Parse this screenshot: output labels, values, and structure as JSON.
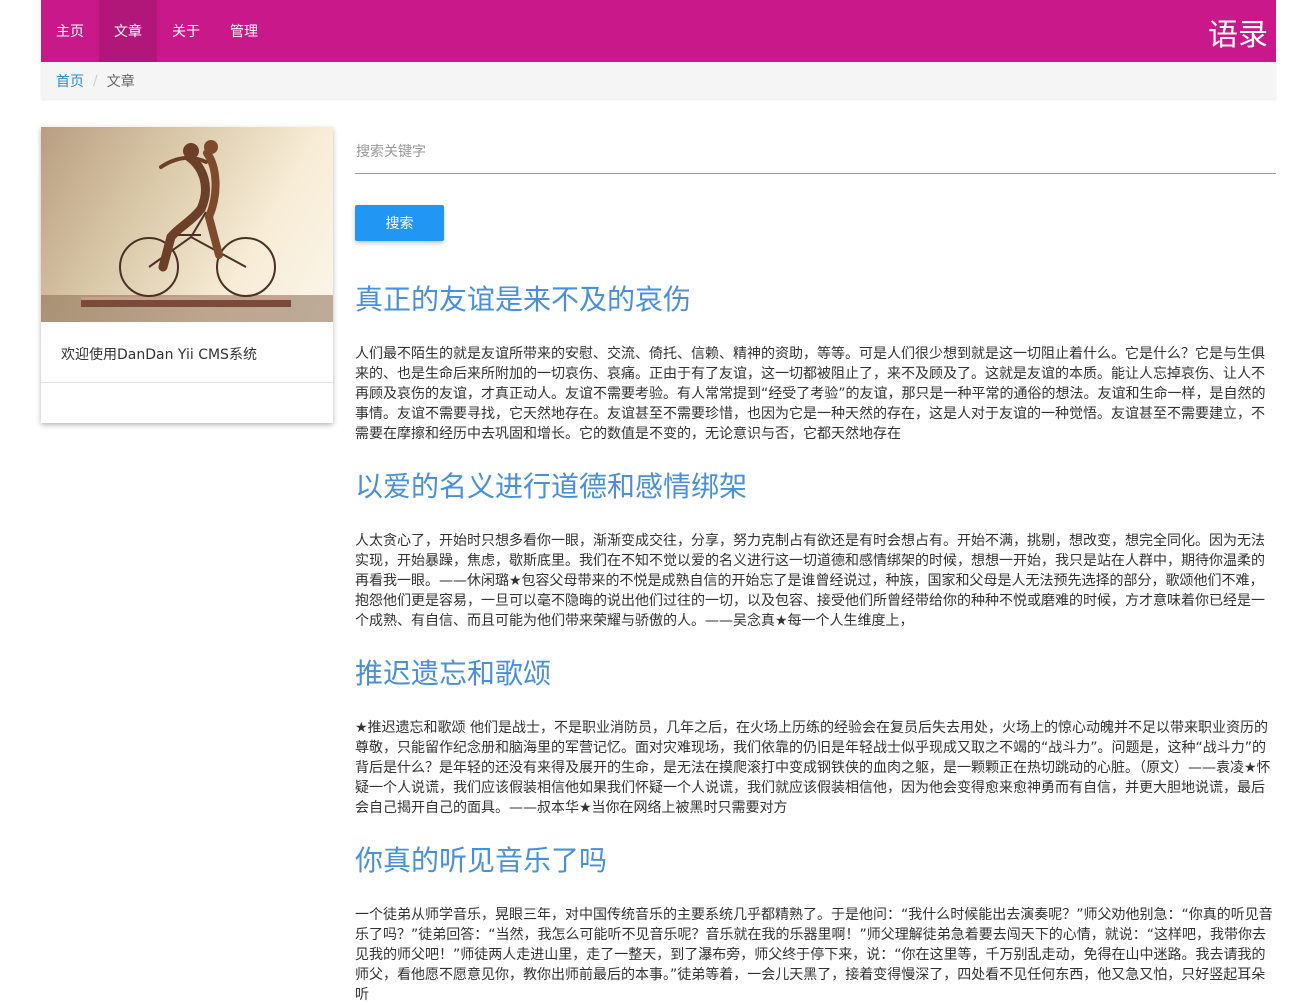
{
  "nav": {
    "items": [
      "主页",
      "文章",
      "关于",
      "管理"
    ],
    "active_index": 1,
    "brand": "语录",
    "color": "#c9188a"
  },
  "breadcrumb": {
    "home": "首页",
    "separator": "/",
    "current": "文章"
  },
  "sidebar": {
    "card_text": "欢迎使用DanDan Yii CMS系统"
  },
  "search": {
    "placeholder": "搜索关键字",
    "button_label": "搜索"
  },
  "articles": [
    {
      "title": "真正的友谊是来不及的哀伤",
      "body": "人们最不陌生的就是友谊所带来的安慰、交流、倚托、信赖、精神的资助，等等。可是人们很少想到就是这一切阻止着什么。它是什么？它是与生俱来的、也是生命后来所附加的一切哀伤、哀痛。正由于有了友谊，这一切都被阻止了，来不及顾及了。这就是友谊的本质。能让人忘掉哀伤、让人不再顾及哀伤的友谊，才真正动人。友谊不需要考验。有人常常提到“经受了考验”的友谊，那只是一种平常的通俗的想法。友谊和生命一样，是自然的事情。友谊不需要寻找，它天然地存在。友谊甚至不需要珍惜，也因为它是一种天然的存在，这是人对于友谊的一种觉悟。友谊甚至不需要建立，不需要在摩擦和经历中去巩固和增长。它的数值是不变的，无论意识与否，它都天然地存在"
    },
    {
      "title": "以爱的名义进行道德和感情绑架",
      "body": "人太贪心了，开始时只想多看你一眼，渐渐变成交往，分享，努力克制占有欲还是有时会想占有。开始不满，挑剔，想改变，想完全同化。因为无法实现，开始暴躁，焦虑，歇斯底里。我们在不知不觉以爱的名义进行这一切道德和感情绑架的时候，想想一开始，我只是站在人群中，期待你温柔的再看我一眼。——休闲璐★包容父母带来的不悦是成熟自信的开始忘了是谁曾经说过，种族，国家和父母是人无法预先选择的部分，歌颂他们不难，抱怨他们更是容易，一旦可以毫不隐晦的说出他们过往的一切，以及包容、接受他们所曾经带给你的种种不悦或磨难的时候，方才意味着你已经是一个成熟、有自信、而且可能为他们带来荣耀与骄傲的人。——吴念真★每一个人生维度上，"
    },
    {
      "title": "推迟遗忘和歌颂",
      "body": "★推迟遗忘和歌颂 他们是战士，不是职业消防员，几年之后，在火场上历练的经验会在复员后失去用处，火场上的惊心动魄并不足以带来职业资历的尊敬，只能留作纪念册和脑海里的军营记忆。面对灾难现场，我们依靠的仍旧是年轻战士似乎现成又取之不竭的“战斗力”。问题是，这种“战斗力”的背后是什么？是年轻的还没有来得及展开的生命，是无法在摸爬滚打中变成钢铁侠的血肉之躯，是一颗颗正在热切跳动的心脏。（原文）——袁凌★怀疑一个人说谎，我们应该假装相信他如果我们怀疑一个人说谎，我们就应该假装相信他，因为他会变得愈来愈神勇而有自信，并更大胆地说谎，最后会自己揭开自己的面具。——叔本华★当你在网络上被黑时只需要对方"
    },
    {
      "title": "你真的听见音乐了吗",
      "body": "一个徒弟从师学音乐，晃眼三年，对中国传统音乐的主要系统几乎都精熟了。于是他问：“我什么时候能出去演奏呢？”师父劝他别急：“你真的听见音乐了吗？”徒弟回答：“当然，我怎么可能听不见音乐呢？音乐就在我的乐器里啊！”师父理解徒弟急着要去闯天下的心情，就说：“这样吧，我带你去见我的师父吧！”师徒两人走进山里，走了一整天，到了瀑布旁，师父终于停下来，说：“你在这里等，千万别乱走动，免得在山中迷路。我去请我的师父，看他愿不愿意见你，教你出师前最后的本事。”徒弟等着，一会儿天黑了，接着变得慢深了，四处看不见任何东西，他又急又怕，只好竖起耳朵听"
    }
  ]
}
